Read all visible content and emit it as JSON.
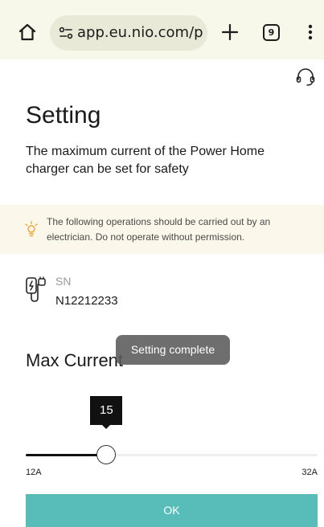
{
  "browser": {
    "url": "app.eu.nio.com/p",
    "tab_count": "9",
    "bar_color": "#f7f8ea"
  },
  "page": {
    "title": "Setting",
    "description": "The maximum current of the Power Home charger can be set for safety",
    "support_icon": "headset-icon"
  },
  "warning": {
    "icon": "lightbulb-icon",
    "text": "The following operations should be carried out by an electrician. Do not operate without permission.",
    "background": "#fbf7ea",
    "icon_color": "#f0a83a"
  },
  "device": {
    "icon": "charger-icon",
    "sn_label": "SN",
    "sn_value": "N12212233"
  },
  "max_current": {
    "title": "Max Current",
    "value": "15",
    "min_label": "12A",
    "max_label": "32A",
    "min": 12,
    "max": 32,
    "current": 15
  },
  "toast": {
    "text": "Setting complete"
  },
  "actions": {
    "ok_label": "OK",
    "ok_color": "#58bdb8"
  }
}
